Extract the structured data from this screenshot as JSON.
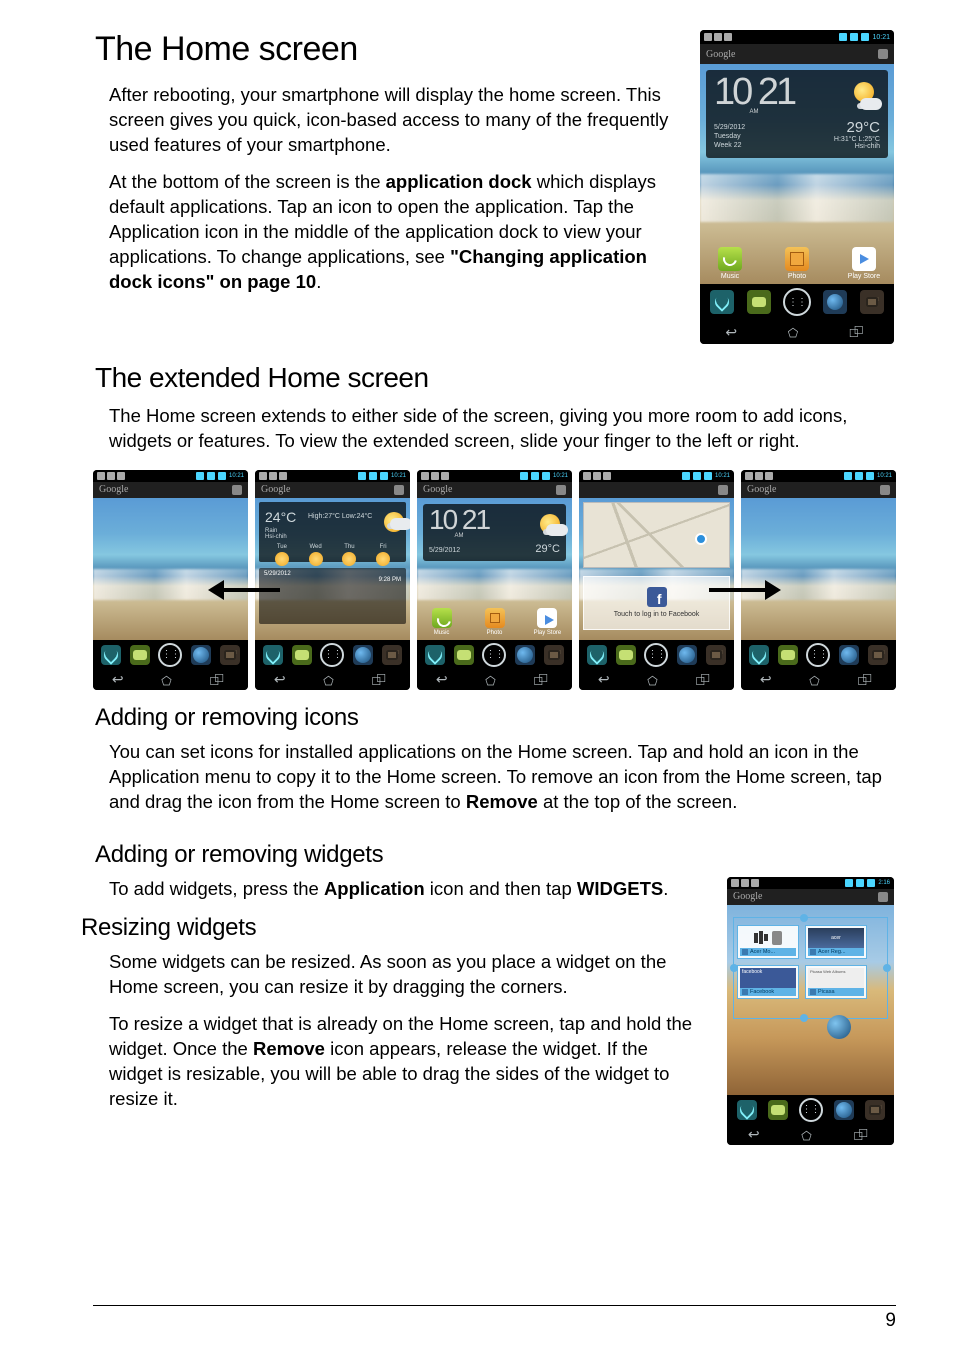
{
  "h1": "The Home screen",
  "p1": "After rebooting, your smartphone will display the home screen. This screen gives you quick, icon-based access to many of the frequently used features of your smartphone.",
  "p2_a": "At the bottom of the screen is the ",
  "p2_b": "application dock",
  "p2_c": " which displays default applications. Tap an icon to open the application. Tap the Application icon in the middle of the application dock to view your applications. To change applications, see ",
  "p2_d": "\"Changing application dock icons\" on page 10",
  "p2_e": ".",
  "h2": "The extended Home screen",
  "p3": "The Home screen extends to either side of the screen, giving you more room to add icons, widgets or features. To view the extended screen, slide your finger to the left or right.",
  "h3a": "Adding or removing icons",
  "p4_a": "You can set icons for installed applications on the Home screen. Tap and hold an icon in the Application menu to copy it to the Home screen. To remove an icon from the Home screen, tap and drag the icon from the Home screen to ",
  "p4_b": "Remove",
  "p4_c": " at the top of the screen.",
  "h3b": "Adding or removing widgets",
  "p5_a": "To add widgets, press the ",
  "p5_b": "Application",
  "p5_c": " icon and then tap ",
  "p5_d": "WIDGETS",
  "p5_e": ".",
  "h3c": "Resizing widgets",
  "p6": "Some widgets can be resized. As soon as you place a widget on the Home screen, you can resize it by dragging the corners.",
  "p7_a": "To resize a widget that is already on the Home screen, tap and hold the widget. Once the ",
  "p7_b": "Remove",
  "p7_c": " icon appears, release the widget. If the widget is resizable, you will be able to drag the sides of the widget to resize it.",
  "pagenum": "9",
  "phone_main": {
    "status_time": "10:21",
    "google": "Google",
    "clock_time": "10 21",
    "am": "AM",
    "date": "5/29/2012",
    "day": "Tuesday",
    "week": "Week 22",
    "temp": "29°C",
    "range": "H:31°C L:25°C",
    "place": "Hsi-chih",
    "icons": {
      "music": "Music",
      "photo": "Photo",
      "play": "Play Store"
    }
  },
  "phone_weather": {
    "status_time": "10:21",
    "google": "Google",
    "temp": "24°C",
    "range": "High:27°C Low:24°C",
    "place": "Rain",
    "city": "Hsi-chih",
    "days": [
      "Tue",
      "Wed",
      "Thu",
      "Fri"
    ],
    "date": "5/29/2012",
    "caltime": "9:28 PM"
  },
  "phone_center": {
    "status_time": "10:21",
    "google": "Google",
    "clock_time": "10 21",
    "am": "AM",
    "date": "5/29/2012",
    "temp": "29°C",
    "icons": {
      "music": "Music",
      "photo": "Photo",
      "play": "Play Store"
    }
  },
  "phone_map": {
    "status_time": "10:21",
    "fb_text": "Touch to log in to Facebook"
  },
  "phone_blank": {
    "status_time": "10:21",
    "google": "Google"
  },
  "phone_widgets": {
    "status_time": "2:16",
    "google": "Google",
    "items": [
      "Acer Mo...",
      "Acer Reg...",
      "Facebook",
      "Picasa"
    ],
    "header1": "facebook",
    "header2": "Picasa Web Albums"
  }
}
